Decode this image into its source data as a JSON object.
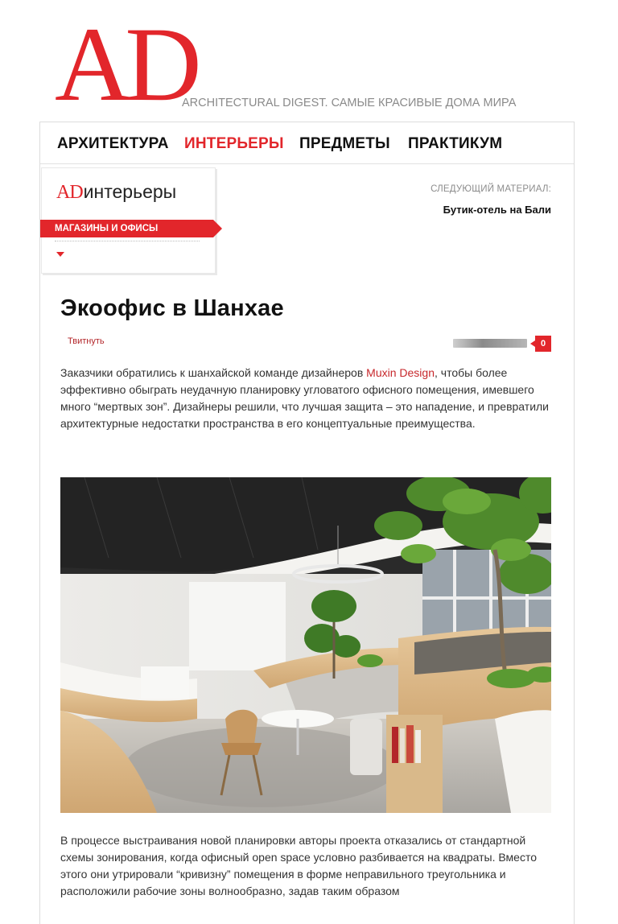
{
  "header": {
    "logo": "AD",
    "tagline": "ARCHITECTURAL DIGEST. САМЫЕ КРАСИВЫЕ ДОМА МИРА"
  },
  "nav": {
    "items": [
      {
        "label": "АРХИТЕКТУРА"
      },
      {
        "label": "ИНТЕРЬЕРЫ"
      },
      {
        "label": "ПРЕДМЕТЫ"
      },
      {
        "label": "ПРАКТИКУМ"
      }
    ],
    "active": "ИНТЕРЬЕРЫ"
  },
  "rubric": {
    "logo_ad": "AD",
    "logo_word": "интерьеры",
    "section": "МАГАЗИНЫ И ОФИСЫ"
  },
  "next_material": {
    "label": "СЛЕДУЮЩИЙ МАТЕРИАЛ:",
    "title": "Бутик-отель на Бали"
  },
  "article": {
    "title": "Экоофис в Шанхае",
    "tweet": "Твитнуть",
    "comments_count": "0",
    "intro_before": "Заказчики обратились к шанхайской команде дизайнеров ",
    "intro_link": "Muxin Design",
    "intro_after": ", чтобы более эффективно обыграть неудачную планировку угловатого офисного помещения, имевшего много “мертвых зон”. Дизайнеры решили, что лучшая защита – это нападение, и превратили архитектурные недостатки пространства в его концептуальные преимущества.",
    "body": "В процессе выстраивания новой планировки авторы проекта отказались от стандартной схемы зонирования, когда офисный open space условно разбивается на квадраты. Вместо этого они утрировали “кривизну” помещения в форме неправильного треугольника и расположили рабочие зоны волнообразно, задав таким образом"
  },
  "colors": {
    "brand_red": "#e2262b",
    "link_red": "#c7282c"
  }
}
